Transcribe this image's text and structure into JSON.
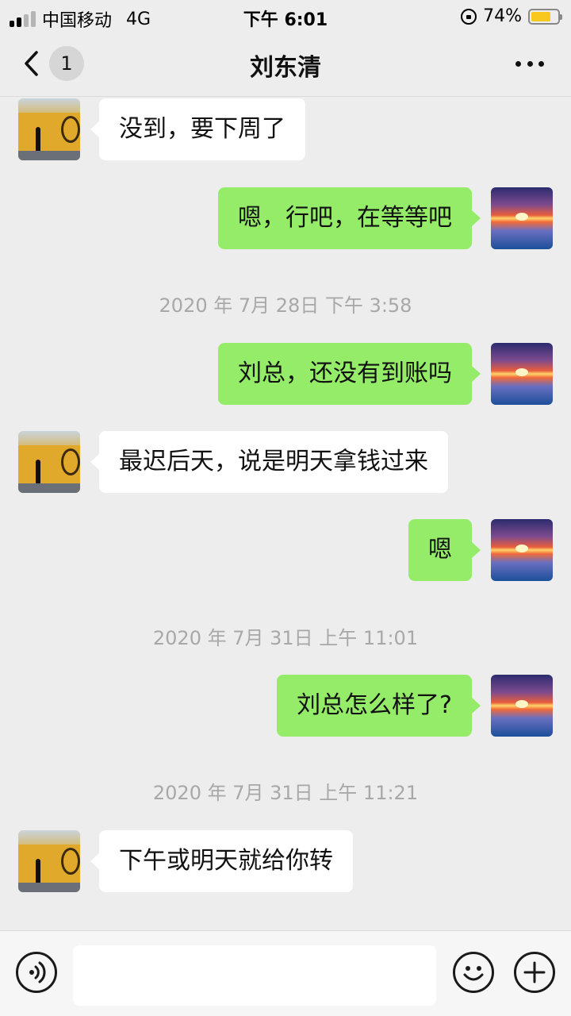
{
  "status_bar": {
    "carrier": "中国移动",
    "network": "4G",
    "time": "下午 6:01",
    "battery_percent": "74%",
    "battery_level": 0.74,
    "battery_color": "#f8c81e"
  },
  "nav": {
    "back_icon": "chevron-left-icon",
    "unread_count": "1",
    "title": "刘东清",
    "more_icon": "more-dots-icon"
  },
  "colors": {
    "incoming_bubble": "#ffffff",
    "outgoing_bubble": "#95ec69",
    "background": "#ededed"
  },
  "messages": [
    {
      "type": "incoming",
      "text": "没到，要下周了"
    },
    {
      "type": "outgoing",
      "text": "嗯，行吧，在等等吧"
    },
    {
      "type": "timestamp",
      "text": "2020 年 7月 28日 下午 3:58"
    },
    {
      "type": "outgoing",
      "text": "刘总，还没有到账吗"
    },
    {
      "type": "incoming",
      "text": "最迟后天，说是明天拿钱过来"
    },
    {
      "type": "outgoing",
      "text": "嗯"
    },
    {
      "type": "timestamp",
      "text": "2020 年 7月 31日 上午 11:01"
    },
    {
      "type": "outgoing",
      "text": "刘总怎么样了?"
    },
    {
      "type": "timestamp",
      "text": "2020 年 7月 31日 上午 11:21"
    },
    {
      "type": "incoming",
      "text": "下午或明天就给你转"
    }
  ],
  "input_bar": {
    "voice_icon": "voice-icon",
    "input_value": "",
    "emoji_icon": "emoji-icon",
    "plus_icon": "plus-icon"
  }
}
